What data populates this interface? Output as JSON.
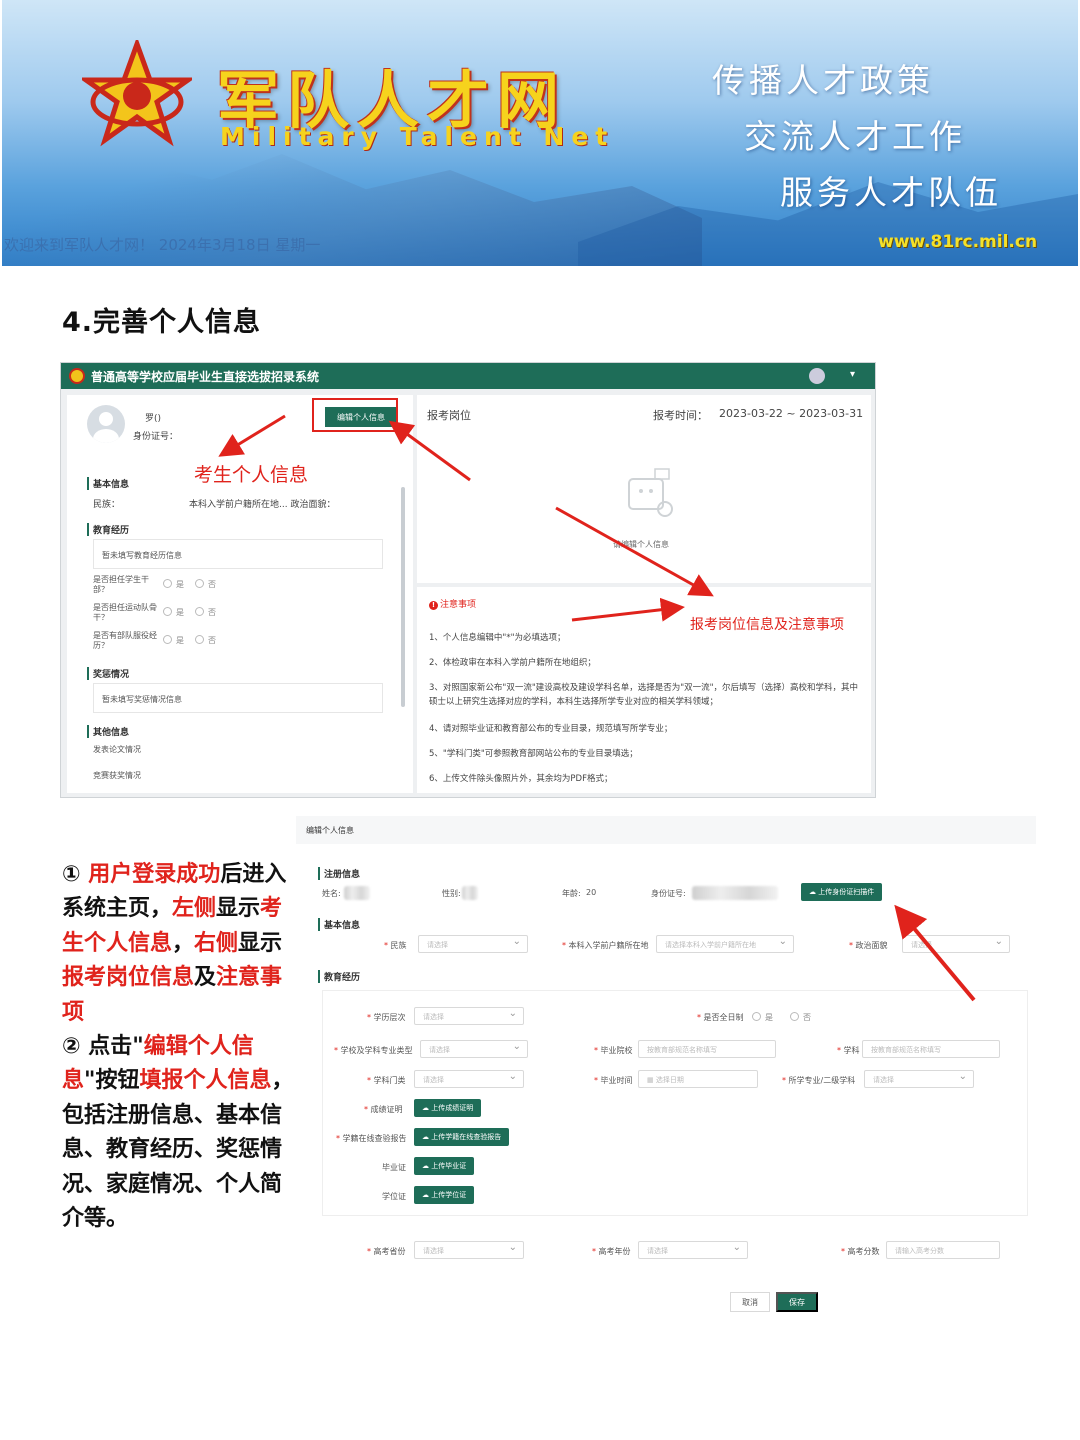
{
  "banner": {
    "logo_cn": "军队人才网",
    "logo_en": "Military Talent Net",
    "slogans": [
      "传播人才政策",
      "交流人才工作",
      "服务人才队伍"
    ],
    "welcome": "欢迎来到军队人才网！ 2024年3月18日 星期一",
    "url": "www.81rc.mil.cn"
  },
  "section_title": "4.完善个人信息",
  "system": {
    "title": "普通高等学校应届毕业生直接选拔招录系统",
    "profile": {
      "name_prefix": "罗()",
      "id_label": "身份证号：",
      "edit_button": "编辑个人信息",
      "basic_info": "基本信息",
      "basic_row": "民族：",
      "basic_row2": "本科入学前户籍所在地...  政治面貌：",
      "education": "教育经历",
      "education_empty": "暂未填写教育经历信息",
      "q1": "是否担任学生干部？",
      "q2": "是否担任运动队骨干？",
      "q3": "是否有部队服役经历？",
      "yes": "是",
      "no": "否",
      "awards": "奖惩情况",
      "awards_empty": "暂未填写奖惩情况信息",
      "other": "其他信息",
      "o1": "发表论文情况",
      "o2": "竞赛获奖情况"
    },
    "position": {
      "label": "报考岗位",
      "time_label": "报考时间：",
      "time_value": "2023-03-22 ~ 2023-03-31",
      "empty_hint": "请编辑个人信息"
    },
    "notice": {
      "title": "注意事项",
      "items": [
        "1、个人信息编辑中\"*\"为必填选项；",
        "2、体检政审在本科入学前户籍所在地组织；",
        "3、对照国家新公布\"双一流\"建设高校及建设学科名单，选择是否为\"双一流\"，尔后填写（选择）高校和学科，其中硕士以上研究生选择对应的学科，本科生选择所学专业对应的相关学科领域；",
        "4、请对照毕业证和教育部公布的专业目录，规范填写所学专业；",
        "5、\"学科门类\"可参照教育部网站公布的专业目录填选；",
        "6、上传文件除头像照片外，其余均为PDF格式；"
      ]
    }
  },
  "annotations": {
    "left": "考生个人信息",
    "right": "报考岗位信息及注意事项"
  },
  "instructions": {
    "p1_num": "① ",
    "p1_a": "用户登录成功",
    "p1_b": "后进入系统主页，",
    "p1_c": "左侧",
    "p1_d": "显示",
    "p1_e": "考生个人信息",
    "p1_f": "，",
    "p1_g": "右侧",
    "p1_h": "显示",
    "p1_i": "报考岗位信息",
    "p1_j": "及",
    "p1_k": "注意事项",
    "p2_num": "② 点击\"",
    "p2_a": "编辑个人信息",
    "p2_b": "\"按钮",
    "p2_c": "填报个人信息",
    "p2_d": "，包括注册信息、基本信息、教育经历、奖惩情况、家庭情况、个人简介等。"
  },
  "form": {
    "header": "编辑个人信息",
    "reg_info": "注册信息",
    "name_label": "姓名:",
    "gender_label": "性别:",
    "age_label": "年龄:",
    "age_value": "20",
    "id_label": "身份证号:",
    "upload_id": "上传身份证扫描件",
    "basic_info": "基本信息",
    "ethnic_label": "民族",
    "ethnic_ph": "请选择",
    "hukou_label": "本科入学前户籍所在地",
    "hukou_ph": "请选择本科入学前户籍所在地",
    "political_label": "政治面貌",
    "education": "教育经历",
    "level_label": "学历层次",
    "fulltime_label": "是否全日制",
    "yes": "是",
    "no": "否",
    "school_type_label": "学校及学科专业类型",
    "school_label": "毕业院校",
    "school_ph": "按教育部规范名称填写",
    "subject_label": "学科",
    "subject_ph": "按教育部规范名称填写",
    "category_label": "学科门类",
    "grad_time_label": "毕业时间",
    "grad_time_ph": "选择日期",
    "major_label": "所学专业/二级学科",
    "transcript_label": "成绩证明",
    "upload_transcript": "上传成绩证明",
    "xuexin_label": "学籍在线查验报告",
    "upload_xuexin": "上传学籍在线查验报告",
    "diploma_label": "毕业证",
    "upload_diploma": "上传毕业证",
    "degree_label": "学位证",
    "upload_degree": "上传学位证",
    "gk_prov_label": "高考省份",
    "gk_year_label": "高考年份",
    "gk_score_label": "高考分数",
    "gk_score_ph": "请输入高考分数",
    "select_ph": "请选择",
    "cancel": "取消",
    "save": "保存"
  },
  "colors": {
    "accent": "#1e6d58",
    "annotation": "#e0231c"
  }
}
